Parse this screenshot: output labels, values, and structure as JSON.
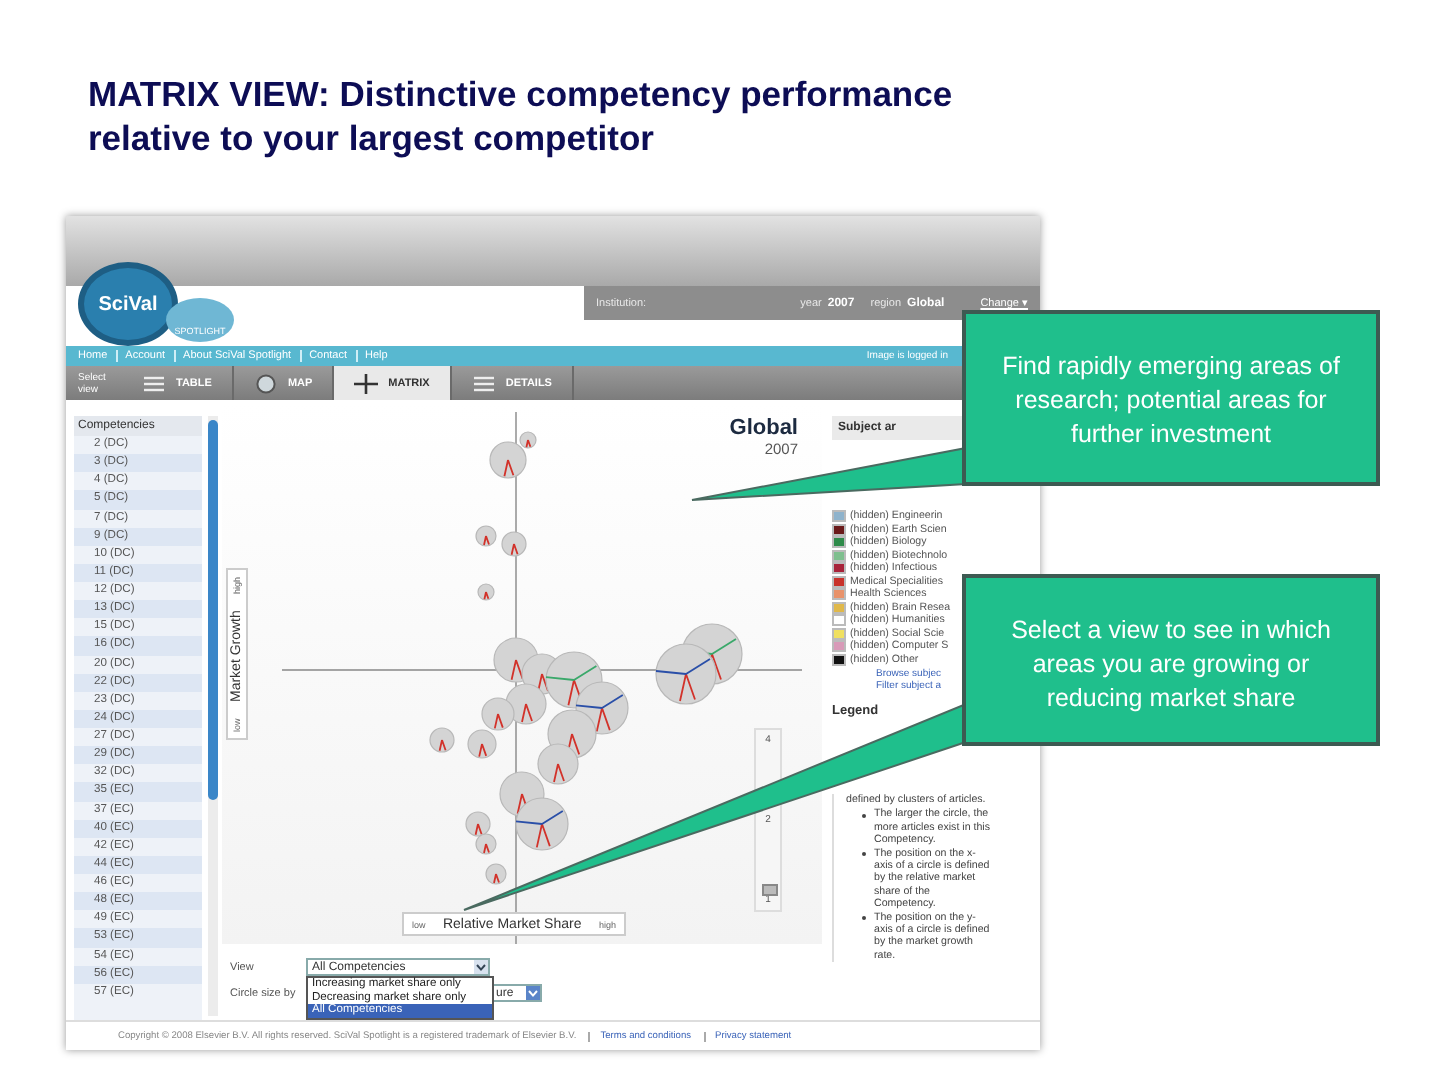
{
  "slide_title": "MATRIX VIEW: Distinctive competency performance relative to your largest competitor",
  "app": {
    "top_bar": {
      "institution_label": "Institution:",
      "year_label": "year",
      "year": "2007",
      "region_label": "region",
      "region": "Global",
      "change_link": "Change ▾"
    },
    "logo": {
      "name": "SciVal",
      "sub": "SPOTLIGHT"
    },
    "nav": {
      "links": [
        "Home",
        "Account",
        "About SciVal Spotlight",
        "Contact",
        "Help"
      ],
      "status": "Image is logged in"
    },
    "toolbar": {
      "label": "Select view",
      "views": [
        {
          "kind": "table",
          "label": "TABLE",
          "selected": false
        },
        {
          "kind": "map",
          "label": "MAP",
          "selected": false
        },
        {
          "kind": "matrix",
          "label": "MATRIX",
          "selected": true
        },
        {
          "kind": "details",
          "label": "DETAILS",
          "selected": false
        }
      ]
    },
    "competencies": {
      "heading": "Competencies",
      "items": [
        "2 (DC)",
        "3 (DC)",
        "4 (DC)",
        "5 (DC)",
        "7 (DC)",
        "9 (DC)",
        "10 (DC)",
        "11 (DC)",
        "12 (DC)",
        "13 (DC)",
        "15 (DC)",
        "16 (DC)",
        "20 (DC)",
        "22 (DC)",
        "23 (DC)",
        "24 (DC)",
        "27 (DC)",
        "29 (DC)",
        "32 (DC)",
        "35 (EC)",
        "37 (EC)",
        "40 (EC)",
        "42 (EC)",
        "44 (EC)",
        "46 (EC)",
        "48 (EC)",
        "49 (EC)",
        "53 (EC)",
        "54 (EC)",
        "56 (EC)",
        "57 (EC)"
      ]
    },
    "chart": {
      "region": "Global",
      "year": "2007",
      "y_axis": {
        "low": "low",
        "label": "Market Growth",
        "high": "high"
      },
      "x_axis": {
        "low": "low",
        "label": "Relative Market Share",
        "high": "high"
      },
      "scale": {
        "labels": [
          "4",
          "2",
          "1"
        ],
        "level": 0.05
      }
    },
    "controls": {
      "view_label": "View",
      "view_value": "All Competencies",
      "options": [
        {
          "label": "Increasing market share only",
          "selected": false
        },
        {
          "label": "Decreasing market share only",
          "selected": false
        },
        {
          "label": "All Competencies",
          "selected": true
        }
      ],
      "size_label": "Circle size by",
      "size_value": "ure"
    },
    "subject_areas": {
      "heading": "Subject ar",
      "items": [
        {
          "label": "(hidden) Engineerin",
          "color": "#8fb3cc"
        },
        {
          "label": "(hidden) Earth Scien",
          "color": "#6b1a1a"
        },
        {
          "label": "(hidden) Biology",
          "color": "#2e8b4a"
        },
        {
          "label": "(hidden) Biotechnolo",
          "color": "#7fbf8f"
        },
        {
          "label": "(hidden) Infectious",
          "color": "#a8233a"
        },
        {
          "label": "Medical Specialities",
          "color": "#c8322a"
        },
        {
          "label": "Health Sciences",
          "color": "#e8926a"
        },
        {
          "label": "(hidden) Brain Resea",
          "color": "#e0b84a"
        },
        {
          "label": "(hidden) Humanities",
          "color": "#ffffff"
        },
        {
          "label": "(hidden) Social Scie",
          "color": "#f0e060"
        },
        {
          "label": "(hidden) Computer S",
          "color": "#d89ab8"
        },
        {
          "label": "(hidden) Other",
          "color": "#111111"
        }
      ],
      "links": [
        "Browse subjec",
        "Filter subject a"
      ]
    },
    "legend": {
      "heading": "Legend",
      "intro": "defined by clusters of articles.",
      "points": [
        "The larger the circle, the more articles exist in this Competency.",
        "The position on the x-axis of a circle is defined by the relative market share of the Competency.",
        "The position on the y-axis of a circle is defined by the market growth rate."
      ]
    },
    "footer": {
      "copyright": "Copyright © 2008 Elsevier B.V. All rights reserved. SciVal Spotlight is a registered trademark of Elsevier B.V.",
      "links": [
        "Terms and conditions",
        "Privacy statement"
      ]
    }
  },
  "callouts": [
    {
      "text": "Find rapidly emerging areas of research; potential areas for further investment"
    },
    {
      "text": "Select a view to see in which areas you are growing or reducing market share"
    }
  ]
}
